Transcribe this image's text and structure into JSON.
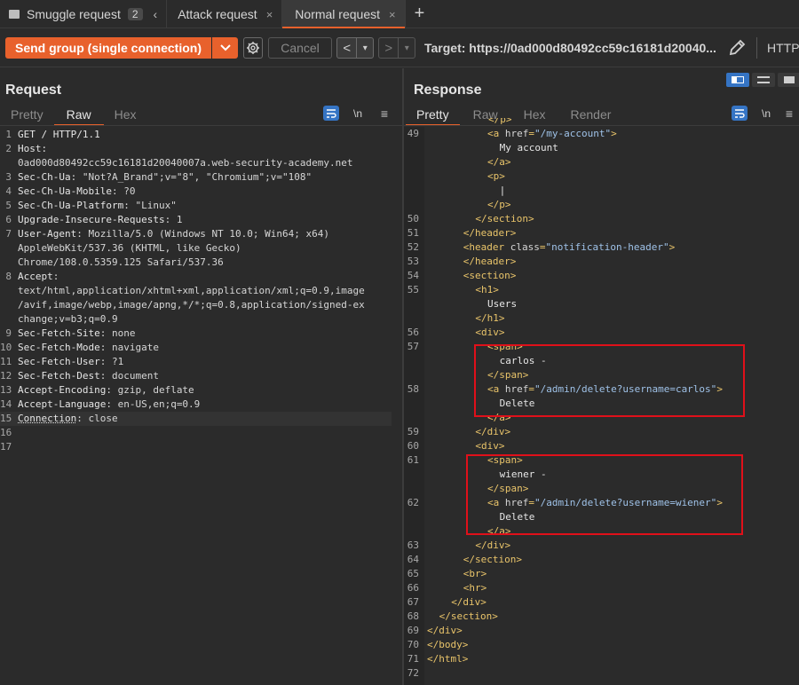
{
  "tabs": [
    {
      "label": "Smuggle request",
      "badge": "2",
      "active": false
    },
    {
      "label": "Attack request",
      "active": false
    },
    {
      "label": "Normal request",
      "active": true
    }
  ],
  "toolbar": {
    "send_label": "Send group (single connection)",
    "cancel_label": "Cancel",
    "prev_label": "<",
    "next_label": ">",
    "target_label": "Target: https://0ad000d80492cc59c16181d20040...",
    "http_label": "HTTP/"
  },
  "request": {
    "title": "Request",
    "tabs": [
      "Pretty",
      "Raw",
      "Hex"
    ],
    "active_tab": "Raw",
    "newline_icon": "\\n",
    "lines": [
      {
        "n": "1",
        "k": "GET / HTTP/1.1",
        "v": ""
      },
      {
        "n": "2",
        "k": "Host:",
        "v": ""
      },
      {
        "n": "",
        "k": "",
        "v": "0ad000d80492cc59c16181d20040007a.web-security-academy.net"
      },
      {
        "n": "3",
        "k": "Sec-Ch-Ua",
        "v": ": \"Not?A_Brand\";v=\"8\", \"Chromium\";v=\"108\""
      },
      {
        "n": "4",
        "k": "Sec-Ch-Ua-Mobile",
        "v": ": ?0"
      },
      {
        "n": "5",
        "k": "Sec-Ch-Ua-Platform",
        "v": ": \"Linux\""
      },
      {
        "n": "6",
        "k": "Upgrade-Insecure-Requests",
        "v": ": 1"
      },
      {
        "n": "7",
        "k": "User-Agent",
        "v": ": Mozilla/5.0 (Windows NT 10.0; Win64; x64)"
      },
      {
        "n": "",
        "k": "",
        "v": "AppleWebKit/537.36 (KHTML, like Gecko)"
      },
      {
        "n": "",
        "k": "",
        "v": "Chrome/108.0.5359.125 Safari/537.36"
      },
      {
        "n": "8",
        "k": "Accept",
        "v": ":"
      },
      {
        "n": "",
        "k": "",
        "v": "text/html,application/xhtml+xml,application/xml;q=0.9,image"
      },
      {
        "n": "",
        "k": "",
        "v": "/avif,image/webp,image/apng,*/*;q=0.8,application/signed-ex"
      },
      {
        "n": "",
        "k": "",
        "v": "change;v=b3;q=0.9"
      },
      {
        "n": "9",
        "k": "Sec-Fetch-Site",
        "v": ": none"
      },
      {
        "n": "10",
        "k": "Sec-Fetch-Mode",
        "v": ": navigate"
      },
      {
        "n": "11",
        "k": "Sec-Fetch-User",
        "v": ": ?1"
      },
      {
        "n": "12",
        "k": "Sec-Fetch-Dest",
        "v": ": document"
      },
      {
        "n": "13",
        "k": "Accept-Encoding",
        "v": ": gzip, deflate"
      },
      {
        "n": "14",
        "k": "Accept-Language",
        "v": ": en-US,en;q=0.9"
      },
      {
        "n": "15",
        "k": "Connection",
        "v": ": close"
      },
      {
        "n": "16",
        "k": "",
        "v": ""
      },
      {
        "n": "17",
        "k": "",
        "v": ""
      }
    ]
  },
  "response": {
    "title": "Response",
    "tabs": [
      "Pretty",
      "Raw",
      "Hex",
      "Render"
    ],
    "active_tab": "Pretty",
    "newline_icon": "\\n",
    "lines": [
      {
        "n": "49",
        "i": 5,
        "parts": [
          [
            "tag",
            "<a "
          ],
          [
            "attr",
            "href"
          ],
          [
            "tag",
            "="
          ],
          [
            "str",
            "\"/my-account\""
          ],
          [
            "tag",
            ">"
          ]
        ]
      },
      {
        "n": "",
        "i": 6,
        "parts": [
          [
            "txt",
            "My account"
          ]
        ]
      },
      {
        "n": "",
        "i": 5,
        "parts": [
          [
            "tag",
            "</a>"
          ]
        ]
      },
      {
        "n": "",
        "i": 5,
        "parts": [
          [
            "tag",
            "<p>"
          ]
        ]
      },
      {
        "n": "",
        "i": 6,
        "parts": [
          [
            "txt",
            "|"
          ]
        ]
      },
      {
        "n": "",
        "i": 5,
        "parts": [
          [
            "tag",
            "</p>"
          ]
        ]
      },
      {
        "n": "50",
        "i": 4,
        "parts": [
          [
            "tag",
            "</section>"
          ]
        ]
      },
      {
        "n": "51",
        "i": 3,
        "parts": [
          [
            "tag",
            "</header>"
          ]
        ]
      },
      {
        "n": "52",
        "i": 3,
        "parts": [
          [
            "tag",
            "<header "
          ],
          [
            "attr",
            "class"
          ],
          [
            "tag",
            "="
          ],
          [
            "str",
            "\"notification-header\""
          ],
          [
            "tag",
            ">"
          ]
        ]
      },
      {
        "n": "53",
        "i": 3,
        "parts": [
          [
            "tag",
            "</header>"
          ]
        ]
      },
      {
        "n": "54",
        "i": 3,
        "parts": [
          [
            "tag",
            "<section>"
          ]
        ]
      },
      {
        "n": "55",
        "i": 4,
        "parts": [
          [
            "tag",
            "<h1>"
          ]
        ]
      },
      {
        "n": "",
        "i": 5,
        "parts": [
          [
            "txt",
            "Users"
          ]
        ]
      },
      {
        "n": "",
        "i": 4,
        "parts": [
          [
            "tag",
            "</h1>"
          ]
        ]
      },
      {
        "n": "56",
        "i": 4,
        "parts": [
          [
            "tag",
            "<div>"
          ]
        ]
      },
      {
        "n": "57",
        "i": 5,
        "parts": [
          [
            "tag",
            "<span>"
          ]
        ]
      },
      {
        "n": "",
        "i": 6,
        "parts": [
          [
            "txt",
            "carlos -"
          ]
        ]
      },
      {
        "n": "",
        "i": 5,
        "parts": [
          [
            "tag",
            "</span>"
          ]
        ]
      },
      {
        "n": "58",
        "i": 5,
        "parts": [
          [
            "tag",
            "<a "
          ],
          [
            "attr",
            "href"
          ],
          [
            "tag",
            "="
          ],
          [
            "str",
            "\"/admin/delete?username=carlos\""
          ],
          [
            "tag",
            ">"
          ]
        ]
      },
      {
        "n": "",
        "i": 6,
        "parts": [
          [
            "txt",
            "Delete"
          ]
        ]
      },
      {
        "n": "",
        "i": 5,
        "parts": [
          [
            "tag",
            "</a>"
          ]
        ]
      },
      {
        "n": "59",
        "i": 4,
        "parts": [
          [
            "tag",
            "</div>"
          ]
        ]
      },
      {
        "n": "60",
        "i": 4,
        "parts": [
          [
            "tag",
            "<div>"
          ]
        ]
      },
      {
        "n": "61",
        "i": 5,
        "parts": [
          [
            "tag",
            "<span>"
          ]
        ]
      },
      {
        "n": "",
        "i": 6,
        "parts": [
          [
            "txt",
            "wiener -"
          ]
        ]
      },
      {
        "n": "",
        "i": 5,
        "parts": [
          [
            "tag",
            "</span>"
          ]
        ]
      },
      {
        "n": "62",
        "i": 5,
        "parts": [
          [
            "tag",
            "<a "
          ],
          [
            "attr",
            "href"
          ],
          [
            "tag",
            "="
          ],
          [
            "str",
            "\"/admin/delete?username=wiener\""
          ],
          [
            "tag",
            ">"
          ]
        ]
      },
      {
        "n": "",
        "i": 6,
        "parts": [
          [
            "txt",
            "Delete"
          ]
        ]
      },
      {
        "n": "",
        "i": 5,
        "parts": [
          [
            "tag",
            "</a>"
          ]
        ]
      },
      {
        "n": "63",
        "i": 4,
        "parts": [
          [
            "tag",
            "</div>"
          ]
        ]
      },
      {
        "n": "64",
        "i": 3,
        "parts": [
          [
            "tag",
            "</section>"
          ]
        ]
      },
      {
        "n": "65",
        "i": 3,
        "parts": [
          [
            "tag",
            "<br>"
          ]
        ]
      },
      {
        "n": "66",
        "i": 3,
        "parts": [
          [
            "tag",
            "<hr>"
          ]
        ]
      },
      {
        "n": "67",
        "i": 2,
        "parts": [
          [
            "tag",
            "</div>"
          ]
        ]
      },
      {
        "n": "68",
        "i": 1,
        "parts": [
          [
            "tag",
            "</section>"
          ]
        ]
      },
      {
        "n": "69",
        "i": 0,
        "parts": [
          [
            "tag",
            "</div>"
          ]
        ]
      },
      {
        "n": "70",
        "i": 0,
        "parts": [
          [
            "tag",
            "</body>"
          ]
        ]
      },
      {
        "n": "71",
        "i": 0,
        "parts": [
          [
            "tag",
            "</html>"
          ]
        ]
      },
      {
        "n": "72",
        "i": 0,
        "parts": []
      }
    ]
  },
  "colors": {
    "accent": "#e8612c",
    "highlight_box": "#e0101a",
    "tag": "#e9c46a",
    "string": "#9fc2e8",
    "active_blue": "#3574c4"
  }
}
